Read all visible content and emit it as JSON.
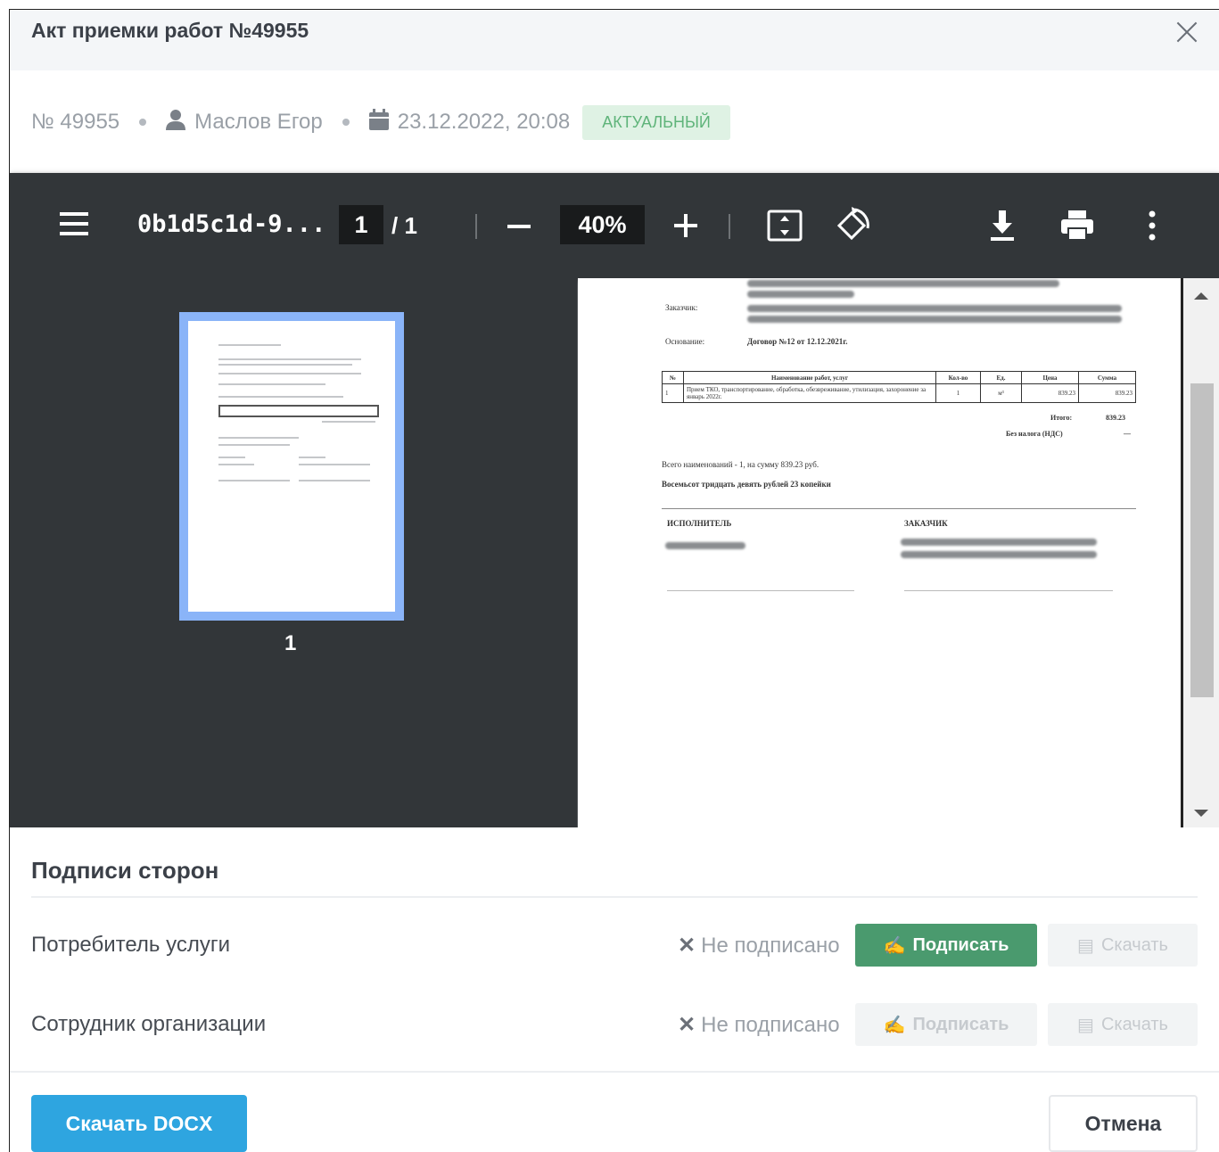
{
  "modal": {
    "title": "Акт приемки работ №49955",
    "meta": {
      "number": "№ 49955",
      "author": "Маслов Егор",
      "datetime": "23.12.2022, 20:08",
      "status": "АКТУАЛЬНЫЙ"
    }
  },
  "viewer": {
    "file_name": "0b1d5c1d-9...",
    "current_page": "1",
    "page_of": "/ 1",
    "zoom": "40%",
    "thumbnail_label": "1",
    "document": {
      "customer_label": "Заказчик:",
      "basis_label": "Основание:",
      "basis_value": "Договор №12 от 12.12.2021г.",
      "table_headers": [
        "№",
        "Наименование работ, услуг",
        "Кол-во",
        "Ед.",
        "Цена",
        "Сумма"
      ],
      "table_rows": [
        [
          "1",
          "Прием ТКО, транспортирование, обработка, обезвреживание, утилизация, захоронение за январь 2022г.",
          "1",
          "м³",
          "839.23",
          "839.23"
        ]
      ],
      "total_label": "Итого:",
      "total_value": "839.23",
      "vat_label": "Без налога (НДС)",
      "vat_value": "—",
      "summary_line": "Всего наименований - 1, на сумму 839.23 руб.",
      "amount_words": "Восемьсот тридцать девять рублей 23 копейки",
      "executor_label": "ИСПОЛНИТЕЛЬ",
      "customer_sign_label": "ЗАКАЗЧИК"
    }
  },
  "signatures": {
    "title": "Подписи сторон",
    "rows": [
      {
        "party": "Потребитель услуги",
        "status": "Не подписано",
        "sign_label": "Подписать",
        "download_label": "Скачать"
      },
      {
        "party": "Сотрудник организации",
        "status": "Не подписано",
        "sign_label": "Подписать",
        "download_label": "Скачать"
      }
    ]
  },
  "footer": {
    "download_docx": "Скачать DOCX",
    "cancel": "Отмена"
  },
  "colors": {
    "accent_blue": "#2ea5e0",
    "sign_green": "#4a9a6e",
    "status_badge_bg": "#dff2e4",
    "status_badge_text": "#5fb47a",
    "viewer_toolbar": "#323639"
  },
  "icons": [
    "close-icon",
    "user-icon",
    "calendar-icon",
    "menu-icon",
    "fit-page-icon",
    "rotate-icon",
    "download-icon",
    "print-icon",
    "more-icon",
    "cross-icon",
    "sign-icon",
    "file-icon"
  ]
}
